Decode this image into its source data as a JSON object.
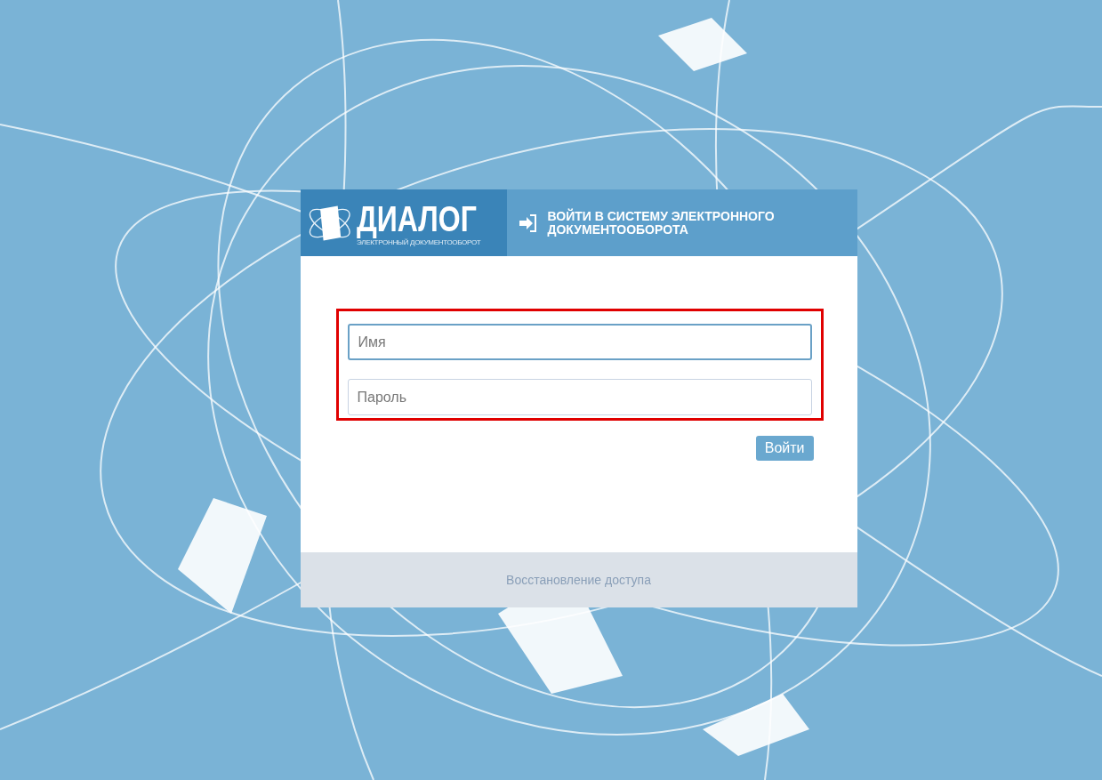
{
  "logo": {
    "name": "ДИАЛОГ",
    "tagline": "ЭЛЕКТРОННЫЙ ДОКУМЕНТООБОРОТ"
  },
  "header": {
    "title": "ВОЙТИ В СИСТЕМУ ЭЛЕКТРОННОГО ДОКУМЕНТООБОРОТА"
  },
  "fields": [
    {
      "placeholder": "Имя",
      "focused": true
    },
    {
      "placeholder": "Пароль",
      "focused": false
    }
  ],
  "login_button": "Войти",
  "footer_link": "Восстановление доступа"
}
